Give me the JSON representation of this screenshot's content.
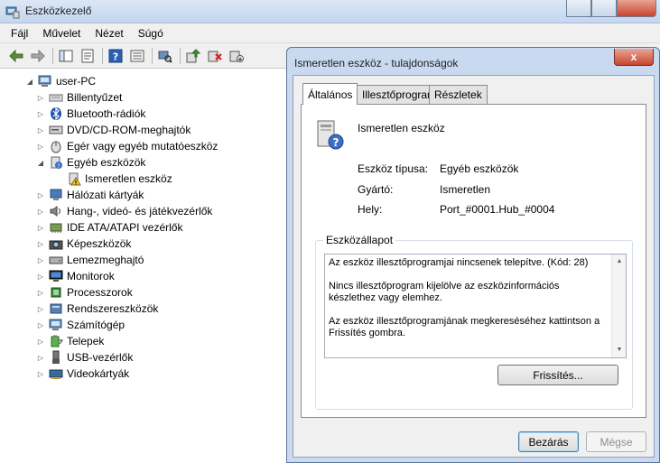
{
  "window": {
    "title": "Eszközkezelő"
  },
  "menu": [
    "Fájl",
    "Művelet",
    "Nézet",
    "Súgó"
  ],
  "tree": {
    "root": "user-PC",
    "items": [
      {
        "label": "Billentyűzet",
        "icon": "keyboard-icon"
      },
      {
        "label": "Bluetooth-rádiók",
        "icon": "bluetooth-icon"
      },
      {
        "label": "DVD/CD-ROM-meghajtók",
        "icon": "dvd-drive-icon"
      },
      {
        "label": "Egér vagy egyéb mutatóeszköz",
        "icon": "mouse-icon"
      },
      {
        "label": "Egyéb eszközök",
        "icon": "other-devices-icon",
        "expanded": true
      },
      {
        "label": "Ismeretlen eszköz",
        "icon": "unknown-device-warning-icon",
        "child": true
      },
      {
        "label": "Hálózati kártyák",
        "icon": "network-adapter-icon"
      },
      {
        "label": "Hang-, videó- és játékvezérlők",
        "icon": "sound-icon"
      },
      {
        "label": "IDE ATA/ATAPI vezérlők",
        "icon": "ide-controller-icon"
      },
      {
        "label": "Képeszközök",
        "icon": "imaging-device-icon"
      },
      {
        "label": "Lemezmeghajtó",
        "icon": "disk-drive-icon"
      },
      {
        "label": "Monitorok",
        "icon": "monitor-icon"
      },
      {
        "label": "Processzorok",
        "icon": "processor-icon"
      },
      {
        "label": "Rendszereszközök",
        "icon": "system-device-icon"
      },
      {
        "label": "Számítógép",
        "icon": "computer-icon"
      },
      {
        "label": "Telepek",
        "icon": "battery-icon"
      },
      {
        "label": "USB-vezérlők",
        "icon": "usb-controller-icon"
      },
      {
        "label": "Videokártyák",
        "icon": "display-adapter-icon"
      }
    ]
  },
  "dialog": {
    "title": "Ismeretlen eszköz - tulajdonságok",
    "close_glyph": "x",
    "tabs": [
      "Általános",
      "Illesztőprogram",
      "Részletek"
    ],
    "device_name": "Ismeretlen eszköz",
    "properties": [
      {
        "label": "Eszköz típusa:",
        "value": "Egyéb eszközök"
      },
      {
        "label": "Gyártó:",
        "value": "Ismeretlen"
      },
      {
        "label": "Hely:",
        "value": "Port_#0001.Hub_#0004"
      }
    ],
    "status_group_title": "Eszközállapot",
    "status_lines": [
      "Az eszköz illesztőprogramjai nincsenek telepítve. (Kód: 28)",
      "Nincs illesztőprogram kijelölve az eszközinformációs készlethez vagy elemhez.",
      "Az eszköz illesztőprogramjának megkereséséhez kattintson a Frissítés gombra."
    ],
    "update_button": "Frissítés...",
    "close_button": "Bezárás",
    "cancel_button": "Mégse"
  }
}
